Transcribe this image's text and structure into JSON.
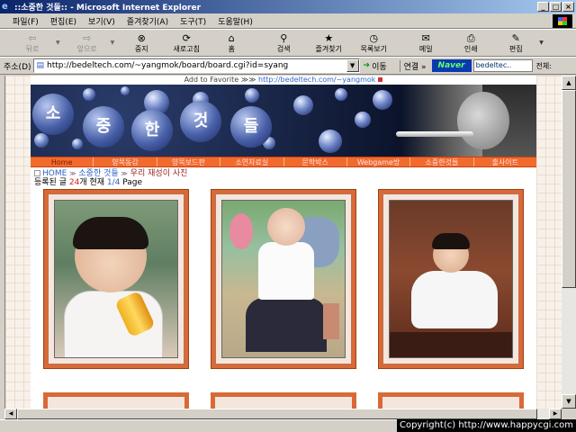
{
  "window": {
    "title": "::소중한 것들:: - Microsoft Internet Explorer",
    "btn_min": "_",
    "btn_max": "□",
    "btn_close": "×"
  },
  "menu": [
    "파일(F)",
    "편집(E)",
    "보기(V)",
    "즐겨찾기(A)",
    "도구(T)",
    "도움말(H)"
  ],
  "toolbar": {
    "back": "뒤로",
    "forward": "앞으로",
    "stop": "중지",
    "refresh": "새로고침",
    "home": "홈",
    "search": "검색",
    "favorites": "즐겨찾기",
    "history": "목록보기",
    "mail": "메일",
    "print": "인쇄",
    "edit": "편집"
  },
  "address": {
    "label": "주소(D)",
    "url": "http://bedeltech.com/~yangmok/board/board.cgi?id=syang",
    "go": "이동",
    "links": "연결 »",
    "naver": "Naver",
    "search_text": "bedeltec..",
    "full": "전체:"
  },
  "page": {
    "favorite": "Add to Favorite ≫≫",
    "favorite_url": "http://bedeltech.com/~yangmok",
    "banner_chars": [
      "소",
      "중",
      "한",
      "것",
      "들"
    ],
    "nav": [
      "Home",
      "양목동감",
      "양목보드판",
      "소연자료실",
      "문학박스",
      "Webgame방",
      "소중한것들",
      "출사이트"
    ],
    "crumb_home": "HOME",
    "crumb_section": "소중한 것들",
    "crumb_current": "우리 재성이 사진",
    "count_prefix": "등록된 글",
    "count_value": "24",
    "count_mid": "개 현재",
    "page_value": "1/4",
    "page_suffix": "Page"
  },
  "statusbar": {
    "copyright": "Copyright(c) http://www.happycgi.com"
  },
  "colors": {
    "titlebar_start": "#0a246a",
    "titlebar_end": "#a6caf0",
    "nav_orange": "#f26b2c",
    "photo_frame": "#d86a38"
  }
}
